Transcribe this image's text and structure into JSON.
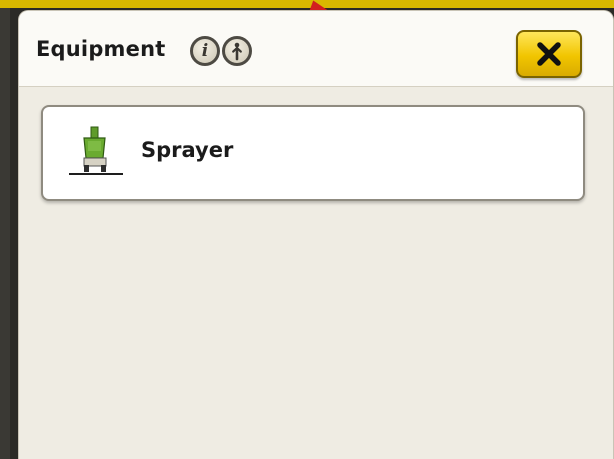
{
  "dialog": {
    "title": "Equipment",
    "header_icons": [
      {
        "name": "info-icon",
        "glyph": "i"
      },
      {
        "name": "diagnostics-icon",
        "glyph": "person-up-arrow"
      }
    ],
    "close_icon": "close-x-icon"
  },
  "equipment_list": [
    {
      "label": "Sprayer",
      "icon": "sprayer-icon"
    }
  ],
  "colors": {
    "close_button": "#f1c500",
    "dialog_background": "#efece3",
    "header_background": "#fbfaf6",
    "sprayer_green": "#5f9b2a",
    "pointer_red": "#d21f1f"
  }
}
